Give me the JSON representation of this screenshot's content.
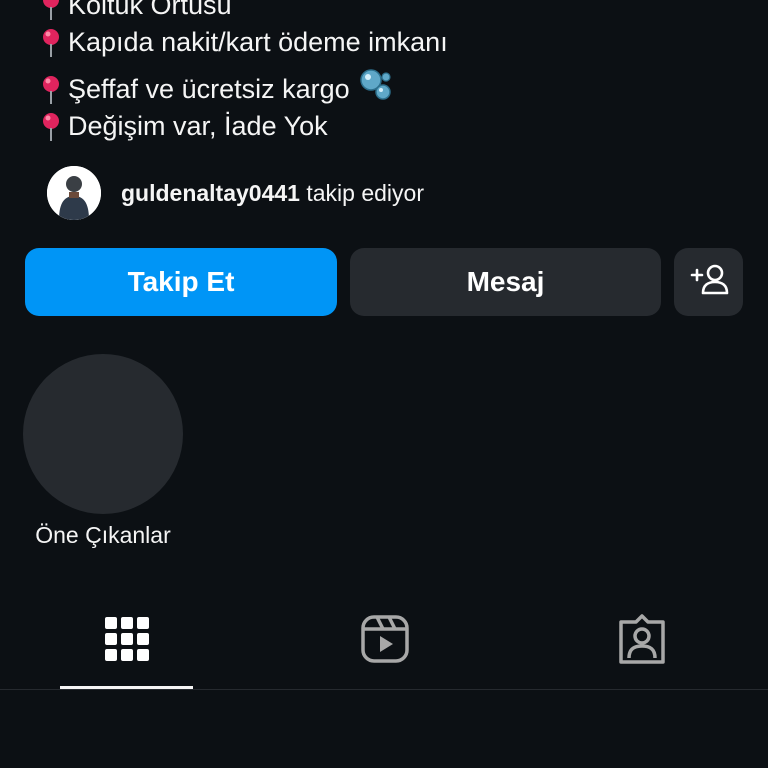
{
  "bio": {
    "lines": [
      "Koltuk Örtüsü",
      "Kapıda nakit/kart ödeme imkanı",
      "Şeffaf ve ücretsiz kargo",
      "Değişim var, İade Yok"
    ],
    "pin_icon": "round-pushpin-icon",
    "bubble_icon": "bubbles-icon"
  },
  "followed_by": {
    "username": "guldenaltay0441",
    "suffix": "takip ediyor"
  },
  "actions": {
    "follow_label": "Takip Et",
    "message_label": "Mesaj",
    "add_user_icon": "add-user-icon"
  },
  "highlights": {
    "label": "Öne Çıkanlar"
  },
  "tabs": [
    {
      "icon": "grid-icon",
      "selected": true
    },
    {
      "icon": "reels-icon",
      "selected": false
    },
    {
      "icon": "tagged-icon",
      "selected": false
    }
  ],
  "colors": {
    "background": "#0c1014",
    "primary_button": "#0095f6",
    "secondary_button": "#262a2f",
    "text": "#f5f5f5",
    "pin": "#e0245e"
  }
}
